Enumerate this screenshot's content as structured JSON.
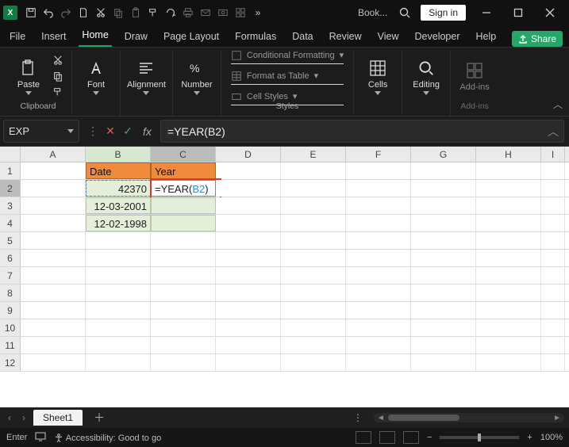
{
  "titlebar": {
    "doc_title": "Book...",
    "signin": "Sign in",
    "excel_letter": "X"
  },
  "tabs": {
    "file": "File",
    "insert": "Insert",
    "home": "Home",
    "draw": "Draw",
    "page_layout": "Page Layout",
    "formulas": "Formulas",
    "data": "Data",
    "review": "Review",
    "view": "View",
    "developer": "Developer",
    "help": "Help",
    "share": "Share"
  },
  "ribbon": {
    "clipboard": {
      "paste": "Paste",
      "label": "Clipboard"
    },
    "font": {
      "label": "Font",
      "button": "Font"
    },
    "alignment": {
      "label": "Alignment",
      "button": "Alignment"
    },
    "number": {
      "label": "Number",
      "button": "Number"
    },
    "styles": {
      "cond": "Conditional Formatting",
      "table": "Format as Table",
      "cell": "Cell Styles",
      "label": "Styles"
    },
    "cells": {
      "button": "Cells"
    },
    "editing": {
      "button": "Editing"
    },
    "addins": {
      "button": "Add-ins",
      "label": "Add-ins"
    }
  },
  "formula_bar": {
    "name_box": "EXP",
    "formula_prefix": "=YEAR(",
    "formula_ref": "B2",
    "formula_suffix": ")"
  },
  "grid": {
    "columns": [
      "A",
      "B",
      "C",
      "D",
      "E",
      "F",
      "G",
      "H",
      "I"
    ],
    "rows": [
      "1",
      "2",
      "3",
      "4",
      "5",
      "6",
      "7",
      "8",
      "9",
      "10",
      "11",
      "12"
    ],
    "headers": {
      "B1": "Date",
      "C1": "Year"
    },
    "data": {
      "B2": "42370",
      "B3": "12-03-2001",
      "B4": "12-02-1998"
    },
    "editing_cell": {
      "prefix": "=YEAR(",
      "ref": "B2",
      "suffix": ")"
    }
  },
  "sheet": {
    "name": "Sheet1"
  },
  "status": {
    "mode": "Enter",
    "accessibility": "Accessibility: Good to go",
    "zoom": "100%"
  }
}
